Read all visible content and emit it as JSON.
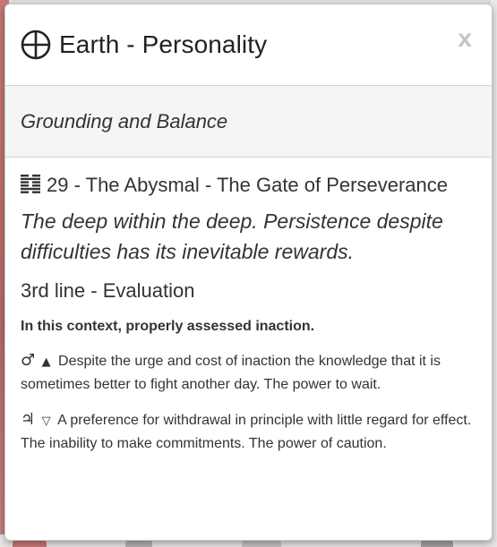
{
  "modal": {
    "title": "Earth - Personality",
    "close_label": "x",
    "subtitle": "Grounding and Balance",
    "gate": {
      "title": "29 - The Abysmal - The Gate of Perseverance",
      "description": "The deep within the deep. Persistence despite difficulties has its inevitable rewards."
    },
    "line": {
      "title": "3rd line - Evaluation",
      "context": "In this context, properly assessed inaction.",
      "exaltation": {
        "planet_symbol": "♂",
        "triangle_symbol": "▲",
        "text": "Despite the urge and cost of inaction the knowledge that it is sometimes better to fight another day. The power to wait."
      },
      "detriment": {
        "planet_symbol": "♃",
        "triangle_symbol": "▽",
        "text": "A preference for withdrawal in principle with little regard for effect. The inability to make commitments. The power of caution."
      }
    }
  },
  "icons": {
    "header": "earth-icon",
    "gate": "hexagram-icon",
    "close": "close-icon"
  },
  "colors": {
    "close": "#c4c4c4",
    "text": "#333333",
    "subheader_bg": "#f5f5f5"
  }
}
